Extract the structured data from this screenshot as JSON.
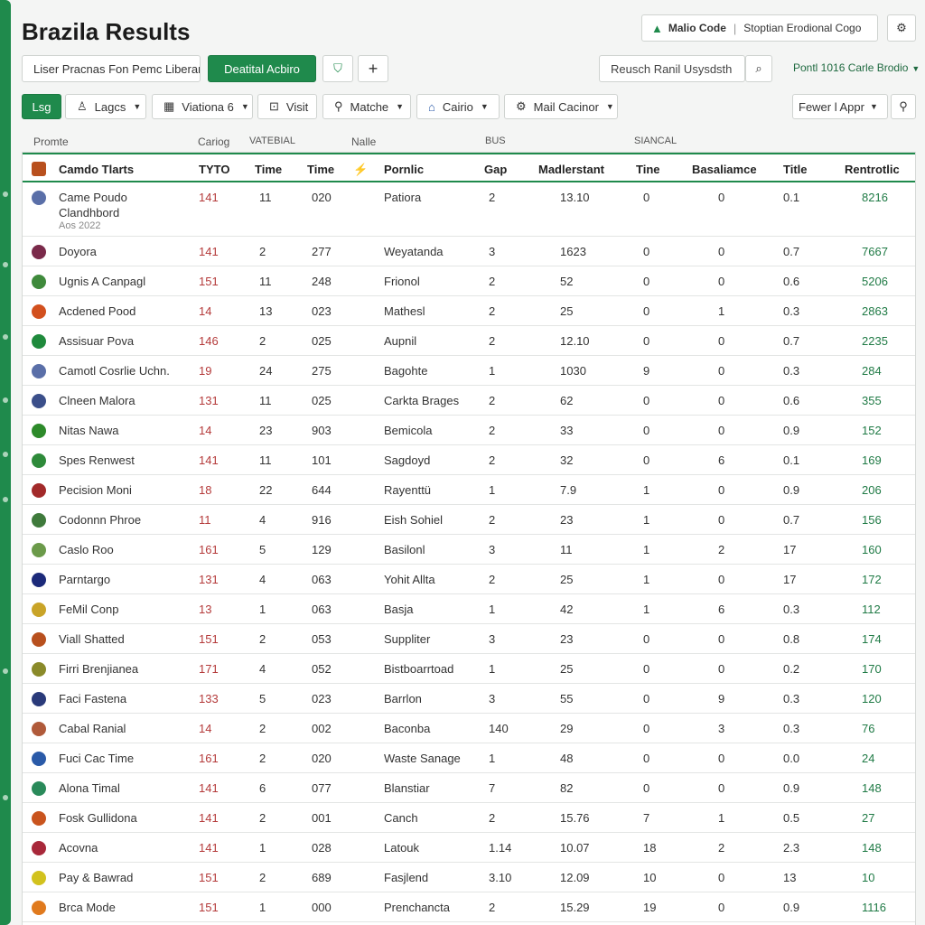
{
  "app": {
    "title": "Brazila Results"
  },
  "header_right": {
    "brand_label": "Malio Code",
    "sub_label": "Stoptian Erodional Cogo"
  },
  "toolbar": {
    "filter_text": "Liser Pracnas Fon Pemc Liberan",
    "primary_button": "Deatital Acbiro",
    "search_placeholder": "Reusch Ranil Usysdsth",
    "right_link": "Pontl 1016 Carle Brodio"
  },
  "filters": {
    "log": "Lsg",
    "leagues": "Lagcs",
    "stations": "Viationa 6",
    "visit": "Visit",
    "matches": "Matche",
    "cairo": "Cairio",
    "mail": "Mail Cacinor",
    "fewer": "Fewer l Appr"
  },
  "colgroups": [
    "Promte",
    "Cariog",
    "VATEBIAL",
    "Nalle",
    "BUS",
    "SIANCAL"
  ],
  "columns": [
    "Camdo Tlarts",
    "TYTO",
    "Time",
    "Time",
    "Pornlic",
    "Gap",
    "Madlerstant",
    "Tine",
    "Basaliamce",
    "Title",
    "Rentrotlic"
  ],
  "rows": [
    {
      "team": "Came Poudo",
      "team2": "Clandhbord",
      "sub": "Aos 2022",
      "c1": "141",
      "c2": "11",
      "c3": "020",
      "opp": "Patiora",
      "gap": "2",
      "m": "13.10",
      "t": "0",
      "b": "0",
      "ti": "0.1",
      "r": "8216",
      "logo": "#5a6fa8"
    },
    {
      "team": "Doyora",
      "c1": "141",
      "c2": "2",
      "c3": "277",
      "opp": "Weyatanda",
      "gap": "3",
      "m": "1623",
      "t": "0",
      "b": "0",
      "ti": "0.7",
      "r": "7667",
      "logo": "#7a2a4a"
    },
    {
      "team": "Ugnis A Canpagl",
      "c1": "151",
      "c2": "11",
      "c3": "248",
      "opp": "Frionol",
      "gap": "2",
      "m": "52",
      "t": "0",
      "b": "0",
      "ti": "0.6",
      "r": "5206",
      "logo": "#3f8a3c"
    },
    {
      "team": "Acdened Pood",
      "c1": "14",
      "c2": "13",
      "c3": "023",
      "opp": "Mathesl",
      "gap": "2",
      "m": "25",
      "t": "0",
      "b": "1",
      "ti": "0.3",
      "r": "2863",
      "logo": "#d2501e"
    },
    {
      "team": "Assisuar Pova",
      "c1": "146",
      "c2": "2",
      "c3": "025",
      "opp": "Aupnil",
      "gap": "2",
      "m": "12.10",
      "t": "0",
      "b": "0",
      "ti": "0.7",
      "r": "2235",
      "logo": "#1f8a3c"
    },
    {
      "team": "Camotl Cosrlie Uchn.",
      "c1": "19",
      "c2": "24",
      "c3": "275",
      "opp": "Bagohte",
      "gap": "1",
      "m": "1030",
      "t": "9",
      "b": "0",
      "ti": "0.3",
      "r": "284",
      "logo": "#5a6fa8"
    },
    {
      "team": "Clneen Malora",
      "c1": "131",
      "c2": "11",
      "c3": "025",
      "opp": "Carkta Brages",
      "gap": "2",
      "m": "62",
      "t": "0",
      "b": "0",
      "ti": "0.6",
      "r": "355",
      "logo": "#3b4f8a"
    },
    {
      "team": "Nitas Nawa",
      "c1": "14",
      "c2": "23",
      "c3": "903",
      "opp": "Bemicola",
      "gap": "2",
      "m": "33",
      "t": "0",
      "b": "0",
      "ti": "0.9",
      "r": "152",
      "logo": "#2d8a2a"
    },
    {
      "team": "Spes Renwest",
      "c1": "141",
      "c2": "11",
      "c3": "101",
      "opp": "Sagdoyd",
      "gap": "2",
      "m": "32",
      "t": "0",
      "b": "6",
      "ti": "0.1",
      "r": "169",
      "logo": "#2e8a3a"
    },
    {
      "team": "Pecision Moni",
      "c1": "18",
      "c2": "22",
      "c3": "644",
      "opp": "Rayenttü",
      "gap": "1",
      "m": "7.9",
      "t": "1",
      "b": "0",
      "ti": "0.9",
      "r": "206",
      "logo": "#a22a2a"
    },
    {
      "team": "Codonnn Phroe",
      "c1": "11",
      "c2": "4",
      "c3": "916",
      "opp": "Eish Sohiel",
      "gap": "2",
      "m": "23",
      "t": "1",
      "b": "0",
      "ti": "0.7",
      "r": "156",
      "logo": "#3f7a3c"
    },
    {
      "team": "Caslo Roo",
      "c1": "161",
      "c2": "5",
      "c3": "129",
      "opp": "Basilonl",
      "gap": "3",
      "m": "11",
      "t": "1",
      "b": "2",
      "ti": "17",
      "r": "160",
      "logo": "#6b9a4a"
    },
    {
      "team": "Parntargo",
      "c1": "131",
      "c2": "4",
      "c3": "063",
      "opp": "Yohit Allta",
      "gap": "2",
      "m": "25",
      "t": "1",
      "b": "0",
      "ti": "17",
      "r": "172",
      "logo": "#1c2a7a"
    },
    {
      "team": "FeMil Conp",
      "c1": "13",
      "c2": "1",
      "c3": "063",
      "opp": "Basja",
      "gap": "1",
      "m": "42",
      "t": "1",
      "b": "6",
      "ti": "0.3",
      "r": "112",
      "logo": "#c9a428"
    },
    {
      "team": "Viall Shatted",
      "c1": "151",
      "c2": "2",
      "c3": "053",
      "opp": "Suppliter",
      "gap": "3",
      "m": "23",
      "t": "0",
      "b": "0",
      "ti": "0.8",
      "r": "174",
      "logo": "#b8501e"
    },
    {
      "team": "Firri Brenjianea",
      "c1": "171",
      "c2": "4",
      "c3": "052",
      "opp": "Bistboarrtoad",
      "gap": "1",
      "m": "25",
      "t": "0",
      "b": "0",
      "ti": "0.2",
      "r": "170",
      "logo": "#8a8a2a"
    },
    {
      "team": "Faci Fastena",
      "c1": "133",
      "c2": "5",
      "c3": "023",
      "opp": "Barrlon",
      "gap": "3",
      "m": "55",
      "t": "0",
      "b": "9",
      "ti": "0.3",
      "r": "120",
      "logo": "#2a3a7a"
    },
    {
      "team": "Cabal Ranial",
      "c1": "14",
      "c2": "2",
      "c3": "002",
      "opp": "Baconba",
      "gap": "140",
      "m": "29",
      "t": "0",
      "b": "3",
      "ti": "0.3",
      "r": "76",
      "logo": "#b05a3a"
    },
    {
      "team": "Fuci Cac Time",
      "c1": "161",
      "c2": "2",
      "c3": "020",
      "opp": "Waste Sanage",
      "gap": "1",
      "m": "48",
      "t": "0",
      "b": "0",
      "ti": "0.0",
      "r": "24",
      "logo": "#2a5aa8"
    },
    {
      "team": "Alona Timal",
      "c1": "141",
      "c2": "6",
      "c3": "077",
      "opp": "Blanstiar",
      "gap": "7",
      "m": "82",
      "t": "0",
      "b": "0",
      "ti": "0.9",
      "r": "148",
      "logo": "#2a8a5a"
    },
    {
      "team": "Fosk Gullidona",
      "c1": "141",
      "c2": "2",
      "c3": "001",
      "opp": "Canch",
      "gap": "2",
      "m": "15.76",
      "t": "7",
      "b": "1",
      "ti": "0.5",
      "r": "27",
      "logo": "#c9541e"
    },
    {
      "team": "Acovna",
      "c1": "141",
      "c2": "1",
      "c3": "028",
      "opp": "Latouk",
      "gap": "1.14",
      "m": "10.07",
      "t": "18",
      "b": "2",
      "ti": "2.3",
      "r": "148",
      "logo": "#a8283a"
    },
    {
      "team": "Pay & Bawrad",
      "c1": "151",
      "c2": "2",
      "c3": "689",
      "opp": "Fasjlend",
      "gap": "3.10",
      "m": "12.09",
      "t": "10",
      "b": "0",
      "ti": "13",
      "r": "10",
      "logo": "#d2c21e"
    },
    {
      "team": "Brca Mode",
      "c1": "151",
      "c2": "1",
      "c3": "000",
      "opp": "Prenchancta",
      "gap": "2",
      "m": "15.29",
      "t": "19",
      "b": "0",
      "ti": "0.9",
      "r": "1116",
      "logo": "#e07a1e"
    }
  ]
}
